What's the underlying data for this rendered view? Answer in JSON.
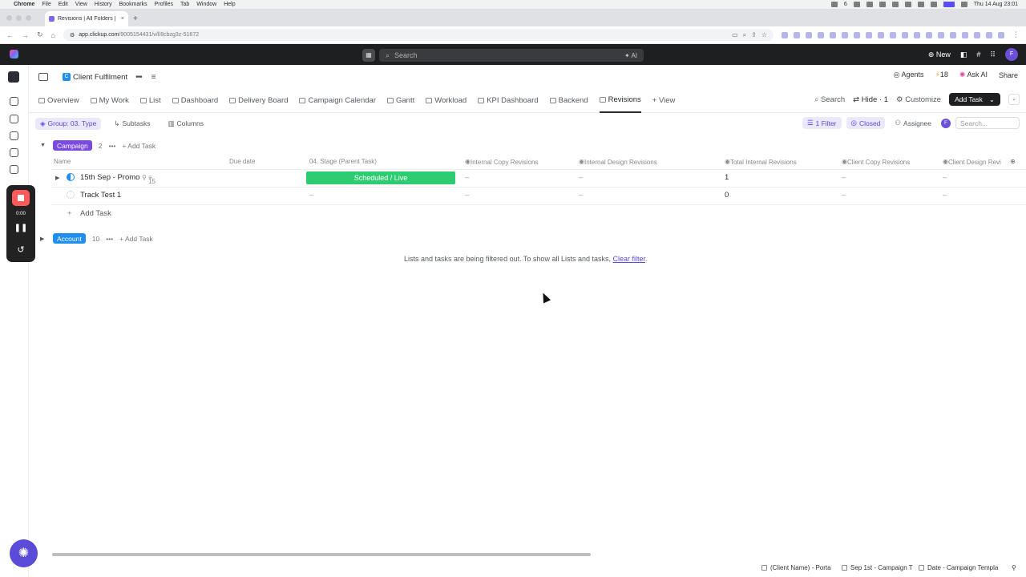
{
  "macos_menu": {
    "apple": "",
    "app": "Chrome",
    "items": [
      "File",
      "Edit",
      "View",
      "History",
      "Bookmarks",
      "Profiles",
      "Tab",
      "Window",
      "Help"
    ],
    "badge_num": "6",
    "clock": "Thu 14 Aug  23:01"
  },
  "browser": {
    "tab_title": "Revisions | All Folders | Everyth",
    "tab_close": "×",
    "new_tab": "+",
    "url_domain": "app.clickup.com",
    "url_path": "/9005154431/v/l/8cbzg3z-51672"
  },
  "topbar": {
    "search_placeholder": "Search",
    "ai_label": "AI",
    "new_label": "New",
    "avatar_initial": "F"
  },
  "location": {
    "space_initial": "C",
    "space_name": "Client Fulfilment",
    "agents_label": "Agents",
    "credits_count": "18",
    "ask_ai_label": "Ask AI",
    "share_label": "Share"
  },
  "views": {
    "tabs": [
      "Overview",
      "My Work",
      "List",
      "Dashboard",
      "Delivery Board",
      "Campaign Calendar",
      "Gantt",
      "Workload",
      "KPI Dashboard",
      "Backend",
      "Revisions"
    ],
    "add_view": "+ View",
    "search_label": "Search",
    "hide_label": "Hide · 1",
    "customize_label": "Customize",
    "add_task_label": "Add Task"
  },
  "filters": {
    "group_label": "Group: 03. Type",
    "subtasks_label": "Subtasks",
    "columns_label": "Columns",
    "filter_label": "1 Filter",
    "closed_label": "Closed",
    "assignee_label": "Assignee",
    "assignee_initial": "F",
    "search_placeholder": "Search..."
  },
  "groups": [
    {
      "name": "Campaign",
      "count": "2",
      "add_task": "Add Task"
    },
    {
      "name": "Account",
      "count": "10",
      "add_task": "Add Task"
    }
  ],
  "columns": [
    "Name",
    "Due date",
    "04. Stage (Parent Task)",
    "Internal Copy Revisions",
    "Internal Design Revisions",
    "Total Internal Revisions",
    "Client Copy Revisions",
    "Client Design Revi"
  ],
  "tasks": [
    {
      "name": "15th Sep - Promo",
      "subtasks": "15",
      "stage": "Scheduled / Live",
      "internal_copy": "–",
      "internal_design": "–",
      "total_internal": "1",
      "client_copy": "–",
      "client_design": "–"
    },
    {
      "name": "Track Test 1",
      "subtasks": "",
      "stage": "–",
      "internal_copy": "–",
      "internal_design": "–",
      "total_internal": "0",
      "client_copy": "–",
      "client_design": "–"
    }
  ],
  "add_task_row": "Add Task",
  "filter_message": {
    "text": "Lists and tasks are being filtered out. To show all Lists and tasks,",
    "link": "Clear filter",
    "tail": "."
  },
  "recorder": {
    "time": "0:00"
  },
  "footer_tabs": [
    "(Client Name) - Porta",
    "Sep 1st - Campaign T",
    "Date - Campaign Templa"
  ],
  "colors": {
    "accent": "#7b68ee",
    "stage_green": "#2ecc71",
    "campaign_pill": "#7b4ae2",
    "account_pill": "#1e8ef0"
  }
}
